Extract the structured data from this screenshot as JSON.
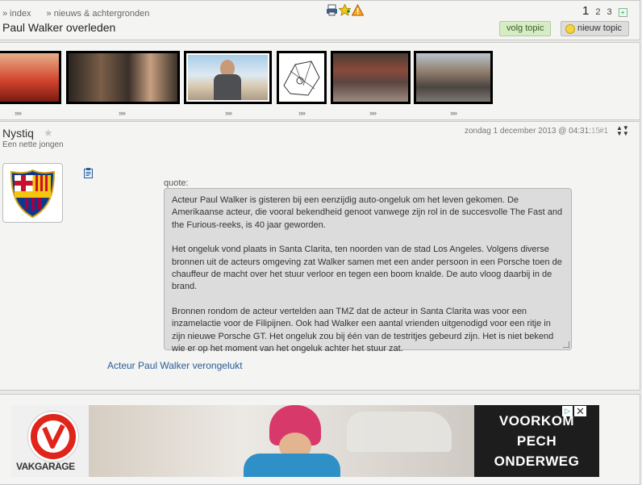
{
  "header": {
    "crumbs": [
      "» index",
      "» nieuws & achtergronden"
    ],
    "title": "Paul Walker overleden",
    "pager": {
      "current": "1",
      "pages": [
        "2",
        "3"
      ]
    },
    "follow_label": "volg topic",
    "new_label": "nieuw topic",
    "icons": [
      "print-icon",
      "favorite-star-icon",
      "warning-icon"
    ]
  },
  "thumbnails": {
    "more_label": "»»",
    "items": [
      "red-sportscar-thumb",
      "movie-still-thumb",
      "portrait-thumb",
      "sketch-thumb",
      "wreck-thumb",
      "crash-site-thumb"
    ]
  },
  "post": {
    "username": "Nystiq",
    "user_title": "Een nette jongen",
    "date": "zondag 1 december 2013 @ 04:31:",
    "date_seconds": "15",
    "post_number": "#1",
    "quote_label": "quote:",
    "quote_paragraphs": [
      "Acteur Paul Walker is gisteren bij een eenzijdig auto-ongeluk om het leven gekomen. De Amerikaanse acteur, die vooral bekendheid genoot vanwege zijn rol in de succesvolle The Fast and the Furious-reeks, is 40 jaar geworden.",
      "Het ongeluk vond plaats in Santa Clarita, ten noorden van de stad Los Angeles. Volgens diverse bronnen uit de acteurs omgeving zat Walker samen met een ander persoon in een Porsche toen de chauffeur de macht over het stuur verloor en tegen een boom knalde. De auto vloog daarbij in de brand.",
      "Bronnen rondom de acteur vertelden aan TMZ dat de acteur in Santa Clarita was voor een inzamelactie voor de Filipijnen. Ook had Walker een aantal vrienden uitgenodigd voor een ritje in zijn nieuwe Porsche GT. Het ongeluk zou bij één van de testritjes gebeurd zijn. Het is niet bekend wie er op het moment van het ongeluk achter het stuur zat."
    ],
    "link_text": "Acteur Paul Walker verongelukt"
  },
  "ad": {
    "brand": "VAKGARAGE",
    "lines": [
      "VOORKOM",
      "PECH",
      "ONDERWEG"
    ],
    "choices_icon": "ad-choices-icon",
    "close_icon": "close-icon"
  },
  "colors": {
    "follow_bg": "#d6ecc4",
    "link": "#2a5d99",
    "quote_bg": "#dcdcdc",
    "brand_red": "#e0251b"
  }
}
